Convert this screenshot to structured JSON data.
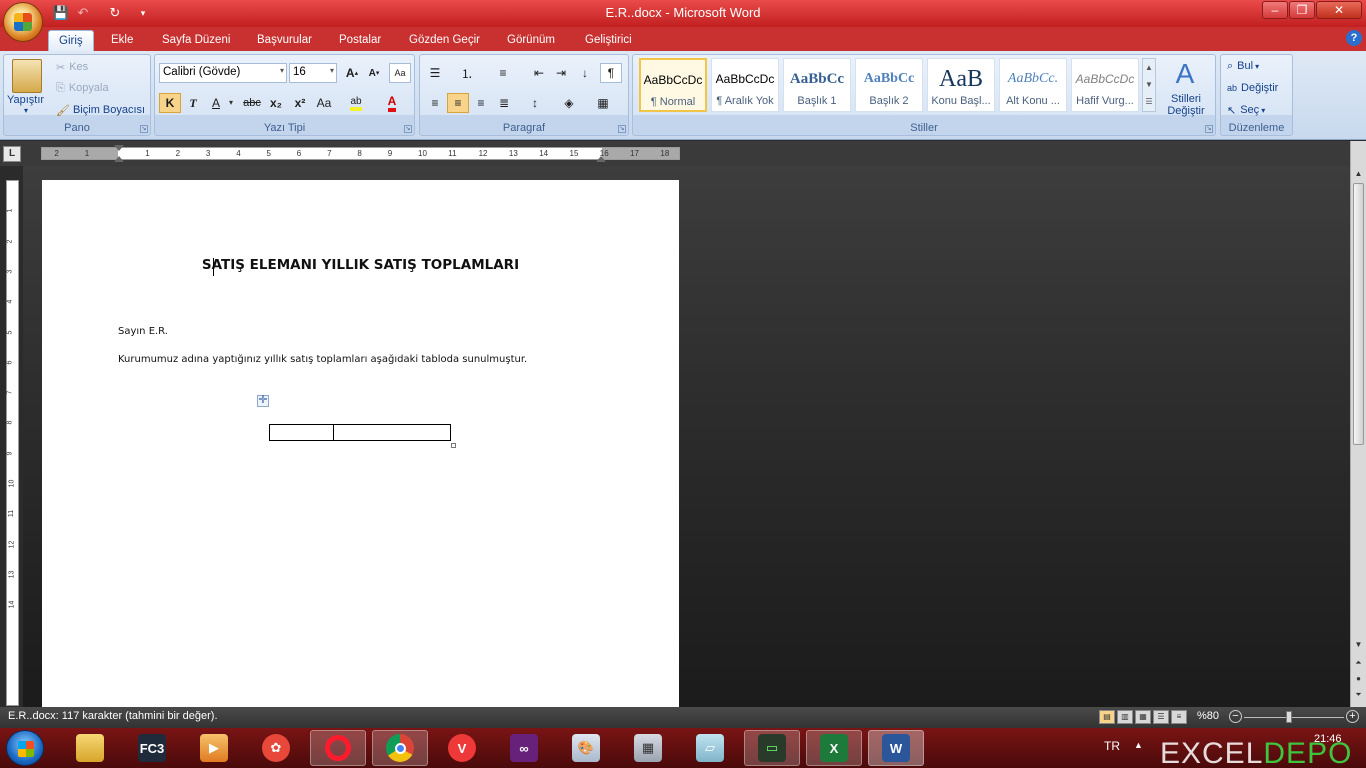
{
  "window": {
    "title": "E.R..docx - Microsoft Word",
    "minimize": "–",
    "maximize": "❐",
    "close": "✕"
  },
  "tabs": [
    "Giriş",
    "Ekle",
    "Sayfa Düzeni",
    "Başvurular",
    "Postalar",
    "Gözden Geçir",
    "Görünüm",
    "Geliştirici"
  ],
  "ribbon": {
    "pano": {
      "label": "Pano",
      "paste": "Yapıştır",
      "cut": "Kes",
      "copy": "Kopyala",
      "format_painter": "Biçim Boyacısı"
    },
    "font": {
      "label": "Yazı Tipi",
      "family": "Calibri (Gövde)",
      "size": "16",
      "bold": "K",
      "italic": "T",
      "underline": "A",
      "strike": "abc",
      "subscript": "x₂",
      "superscript": "x²",
      "case": "Aa"
    },
    "paragraph": {
      "label": "Paragraf"
    },
    "styles": {
      "label": "Stiller",
      "change_styles": "Stilleri Değiştir",
      "items": [
        {
          "sample": "AaBbCcDc",
          "name": "¶ Normal"
        },
        {
          "sample": "AaBbCcDc",
          "name": "¶ Aralık Yok"
        },
        {
          "sample": "AaBbCc",
          "name": "Başlık 1"
        },
        {
          "sample": "AaBbCc",
          "name": "Başlık 2"
        },
        {
          "sample": "AaB",
          "name": "Konu Başl..."
        },
        {
          "sample": "AaBbCc.",
          "name": "Alt Konu ..."
        },
        {
          "sample": "AaBbCcDc",
          "name": "Hafif Vurg..."
        }
      ]
    },
    "editing": {
      "label": "Düzenleme",
      "find": "Bul",
      "replace": "Değiştir",
      "select": "Seç"
    }
  },
  "ruler": {
    "toggle": "L",
    "marks": [
      "2",
      "1",
      "1",
      "2",
      "3",
      "4",
      "5",
      "6",
      "7",
      "8",
      "9",
      "10",
      "11",
      "12",
      "13",
      "14",
      "15",
      "16",
      "17",
      "18"
    ]
  },
  "document": {
    "title": "SATIŞ ELEMANI YILLIK SATIŞ TOPLAMLARI",
    "greeting": "Sayın E.R.",
    "body": "Kurumumuz adına yaptığınız yıllık satış toplamları aşağıdaki tabloda sunulmuştur.",
    "table_handle": "✛"
  },
  "status": {
    "text": "E.R..docx: 117 karakter (tahmini bir değer).",
    "zoom": "%80",
    "zoom_level": 0.45
  },
  "taskbar": {
    "apps": [
      {
        "name": "explorer",
        "label": ""
      },
      {
        "name": "fc3",
        "label": "FC3"
      },
      {
        "name": "media",
        "label": ""
      },
      {
        "name": "paint-app",
        "label": ""
      },
      {
        "name": "opera",
        "label": ""
      },
      {
        "name": "chrome",
        "label": ""
      },
      {
        "name": "vivaldi",
        "label": ""
      },
      {
        "name": "visual-studio",
        "label": ""
      },
      {
        "name": "paint",
        "label": ""
      },
      {
        "name": "calculator",
        "label": ""
      },
      {
        "name": "notes",
        "label": ""
      },
      {
        "name": "terminal",
        "label": ""
      },
      {
        "name": "excel",
        "label": ""
      },
      {
        "name": "word",
        "label": ""
      }
    ],
    "language": "TR",
    "time": "21:46"
  },
  "watermark": {
    "part1": "EXCEL",
    "part2": "DEPO"
  },
  "colors": {
    "titlebar": "#d43030",
    "ribbon": "#dfe9f5",
    "accent": "#15428b"
  }
}
